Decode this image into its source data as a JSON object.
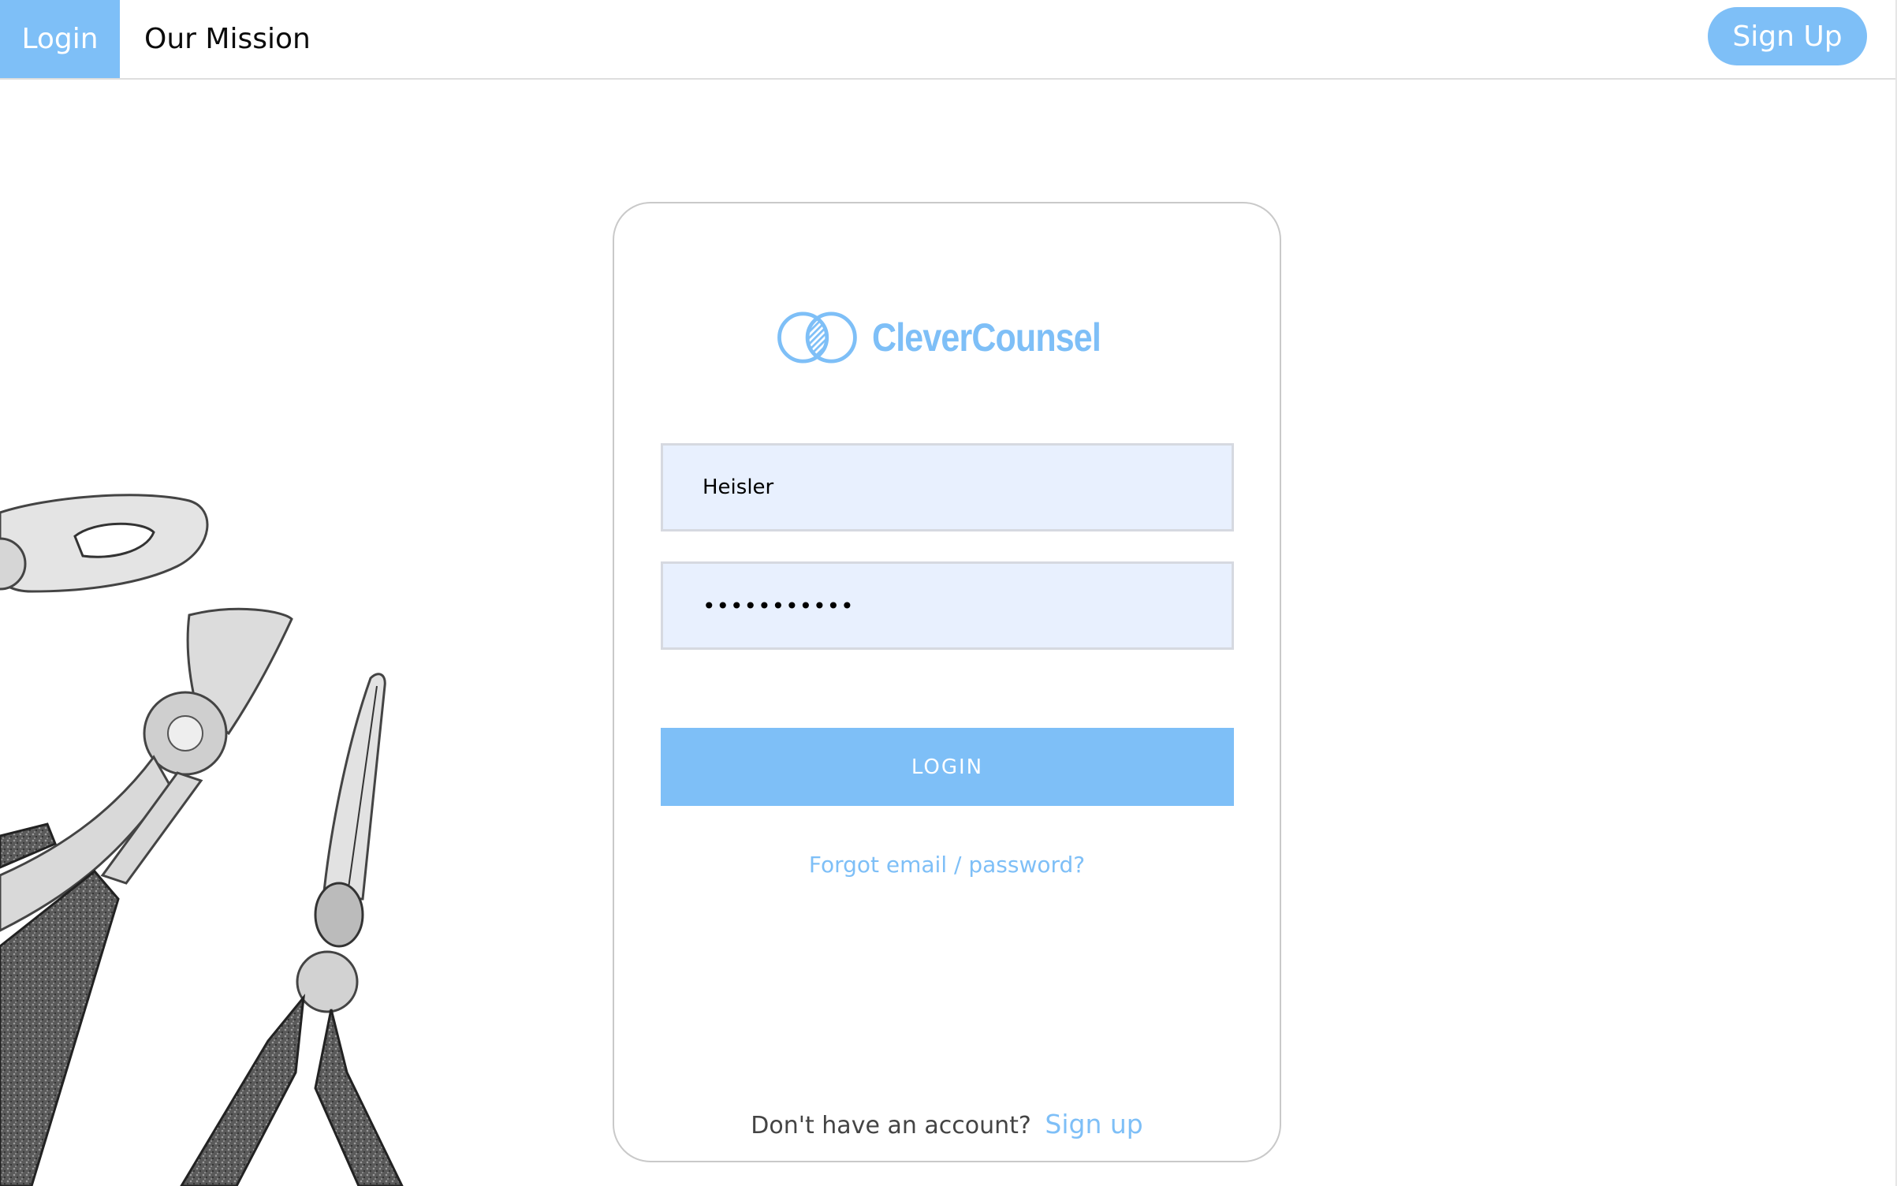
{
  "nav": {
    "login_tab": "Login",
    "mission_tab": "Our Mission",
    "signup_button": "Sign Up"
  },
  "brand": {
    "name": "CleverCounsel",
    "logo_icon": "interlocking-circles-logo"
  },
  "form": {
    "username_value": "Heisler",
    "password_value": "•••••••••••",
    "login_button": "LOGIN",
    "forgot_link": "Forgot email / password?"
  },
  "footer": {
    "no_account_text": "Don't have an account?",
    "signup_link": "Sign up"
  },
  "decoration": {
    "image": "pliers-sketch"
  },
  "colors": {
    "accent": "#7ebff7",
    "input_bg": "#e8f0fe"
  }
}
